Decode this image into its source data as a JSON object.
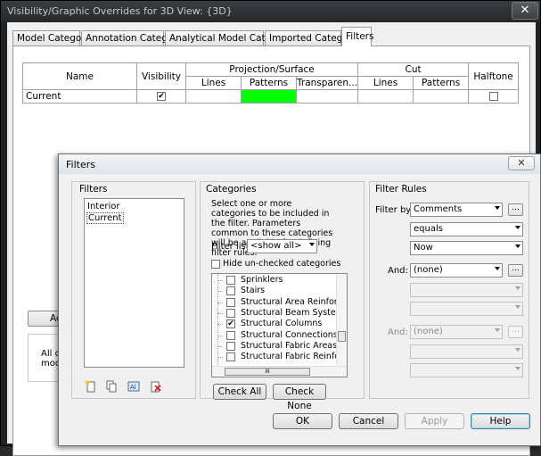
{
  "main_window": {
    "title": "Visibility/Graphic Overrides for 3D View: {3D}",
    "close_glyph": "✕",
    "tabs": [
      "Model Categories",
      "Annotation Categories",
      "Analytical Model Categories",
      "Imported Categories",
      "Filters"
    ],
    "active_tab": "Filters",
    "table": {
      "headers": {
        "name": "Name",
        "visibility": "Visibility",
        "projection_surface": "Projection/Surface",
        "cut": "Cut",
        "halftone": "Halftone",
        "lines": "Lines",
        "patterns": "Patterns",
        "transparency": "Transparen...",
        "cut_lines": "Lines",
        "cut_patterns": "Patterns"
      },
      "rows": [
        {
          "name": "Current",
          "visibility": true,
          "projection_pattern_color": "#00ff00",
          "halftone": false
        }
      ]
    },
    "add_button": "Add",
    "info_text_line1": "All docu",
    "info_text_line2": "modified"
  },
  "filters_dialog": {
    "title": "Filters",
    "close_glyph": "✕",
    "filters_group": {
      "label": "Filters",
      "items": [
        "Interior",
        "Current"
      ],
      "selected": "Current"
    },
    "categories_group": {
      "label": "Categories",
      "description": "Select one or more categories to be included in the filter.  Parameters common to these categories will be available for defining filter rules.",
      "filter_list_label": "Filter list:",
      "filter_list_value": "<show all>",
      "hide_unchecked_label": "Hide un-checked categories",
      "items": [
        {
          "label": "Sprinklers",
          "checked": false
        },
        {
          "label": "Stairs",
          "checked": false
        },
        {
          "label": "Structural Area Reinforcem...",
          "checked": false
        },
        {
          "label": "Structural Beam Systems",
          "checked": false
        },
        {
          "label": "Structural Columns",
          "checked": true
        },
        {
          "label": "Structural Connections",
          "checked": false
        },
        {
          "label": "Structural Fabric Areas",
          "checked": false
        },
        {
          "label": "Structural Fabric Reinforcem",
          "checked": false
        }
      ],
      "scroll_thumb_glyph": "III",
      "check_all": "Check All",
      "check_none": "Check None"
    },
    "rules_group": {
      "label": "Filter Rules",
      "filter_by_label": "Filter by:",
      "filter_by_value": "Comments",
      "operator_value": "equals",
      "rule_value": "Now",
      "and1_label": "And:",
      "and1_value": "(none)",
      "and2_label": "And:",
      "and2_value": "(none)",
      "browse_glyph": "..."
    },
    "buttons": {
      "ok": "OK",
      "cancel": "Cancel",
      "apply": "Apply",
      "help": "Help"
    }
  }
}
